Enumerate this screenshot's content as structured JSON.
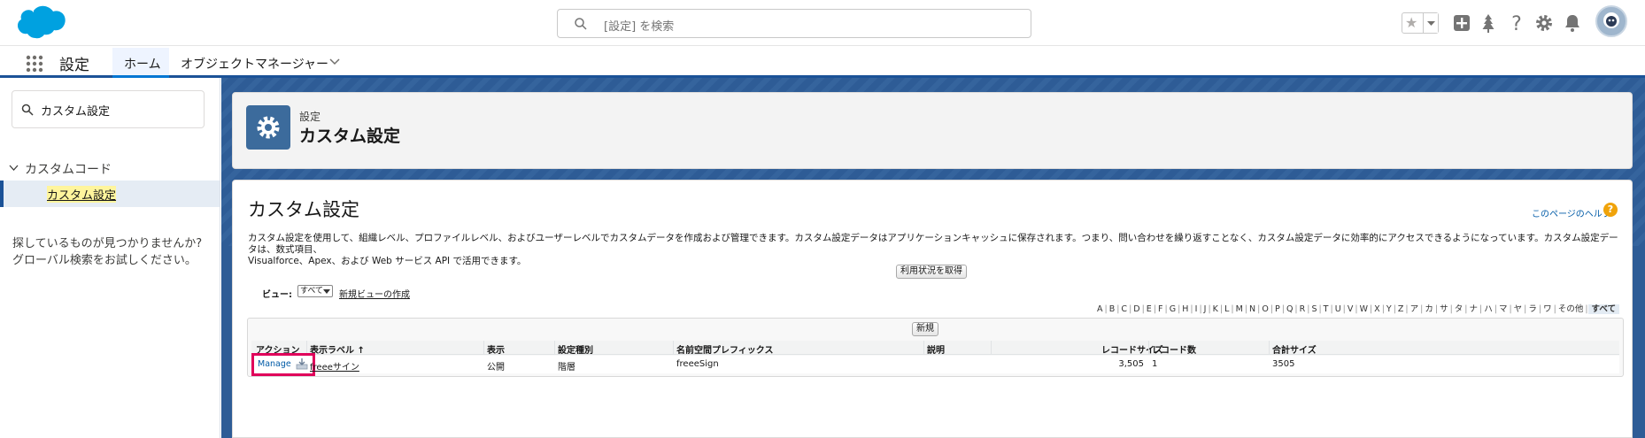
{
  "header": {
    "search_placeholder": "[設定] を検索",
    "icons": [
      "salesforce-cloud-logo",
      "favorites-star-icon",
      "add-icon",
      "trailhead-icon",
      "help-icon",
      "setup-gear-icon",
      "notification-bell-icon",
      "user-avatar"
    ]
  },
  "nav": {
    "app_name": "設定",
    "tabs": [
      {
        "label": "ホーム",
        "active": true
      },
      {
        "label": "オブジェクトマネージャー",
        "has_dropdown": true
      }
    ]
  },
  "sidebar": {
    "quick_find_value": "カスタム設定",
    "tree_section": "カスタムコード",
    "tree_selected": "カスタム設定",
    "help_text_line1": "探しているものが見つかりませんか?",
    "help_text_line2": "グローバル検索をお試しください。"
  },
  "page_header": {
    "breadcrumb": "設定",
    "title": "カスタム設定"
  },
  "content": {
    "title": "カスタム設定",
    "help_link": "このページのヘルプ",
    "description_line1": "カスタム設定を使用して、組織レベル、プロファイルレベル、およびユーザーレベルでカスタムデータを作成および管理できます。カスタム設定データはアプリケーションキャッシュに保存されます。つまり、問い合わせを繰り返すことなく、カスタム設定データに効率的にアクセスできるようになっています。カスタム設定データは、数式項目、",
    "description_line2": "Visualforce、Apex、および Web サービス API で活用できます。",
    "usage_button": "利用状況を取得",
    "view_label": "ビュー:",
    "view_selected": "すべて",
    "view_new_link": "新規ビューの作成",
    "alphabet": [
      "A",
      "B",
      "C",
      "D",
      "E",
      "F",
      "G",
      "H",
      "I",
      "J",
      "K",
      "L",
      "M",
      "N",
      "O",
      "P",
      "Q",
      "R",
      "S",
      "T",
      "U",
      "V",
      "W",
      "X",
      "Y",
      "Z",
      "ア",
      "カ",
      "サ",
      "タ",
      "ナ",
      "ハ",
      "マ",
      "ヤ",
      "ラ",
      "ワ",
      "その他"
    ],
    "alphabet_all": "すべて",
    "new_button": "新規",
    "table": {
      "headers": {
        "action": "アクション",
        "label": "表示ラベル ↑",
        "visibility": "表示",
        "setting_type": "設定種別",
        "namespace": "名前空間プレフィックス",
        "description": "説明",
        "record_size": "レコードサイズ",
        "record_count": "レコード数",
        "total_size": "合計サイズ"
      },
      "rows": [
        {
          "action": "Manage",
          "label": "freeeサイン",
          "visibility": "公開",
          "setting_type": "階層",
          "namespace": "freeeSign",
          "description": "",
          "record_size": "3,505",
          "record_count": "1",
          "total_size": "3505"
        }
      ]
    }
  },
  "colors": {
    "brand_blue": "#0176d3",
    "setup_icon_bg": "#3c6b9c",
    "highlight": "#e0005a",
    "link": "#015ba7"
  }
}
